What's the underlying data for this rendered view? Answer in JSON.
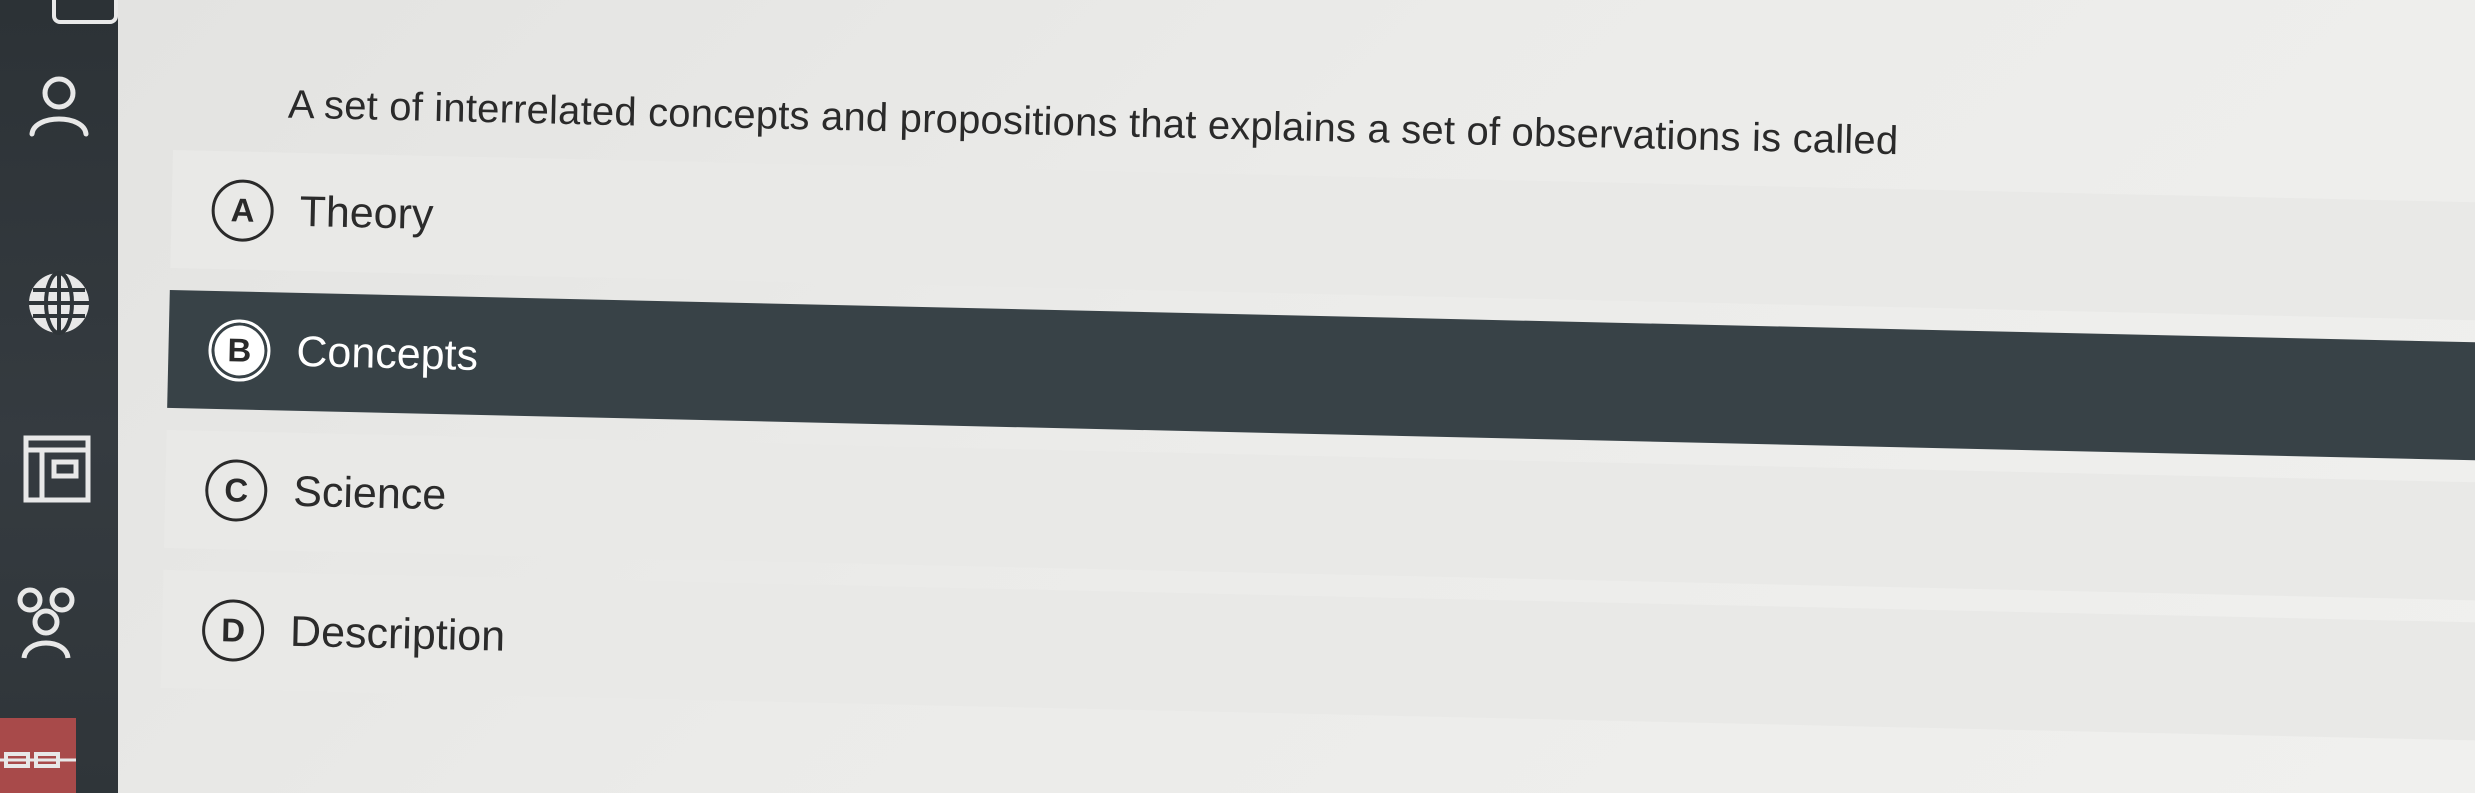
{
  "question": {
    "text": "A set of interrelated concepts and propositions that explains a set of observations is called"
  },
  "options": [
    {
      "letter": "A",
      "label": "Theory",
      "selected": false
    },
    {
      "letter": "B",
      "label": "Concepts",
      "selected": true
    },
    {
      "letter": "C",
      "label": "Science",
      "selected": false
    },
    {
      "letter": "D",
      "label": "Description",
      "selected": false
    }
  ],
  "sidebar": {
    "icons": [
      "profile-icon",
      "globe-icon",
      "calendar-icon",
      "people-icon",
      "grid-icon"
    ]
  },
  "colors": {
    "selected_bg": "#384247",
    "rail_bg": "#2f3539",
    "page_bg": "#e6e6e4",
    "text": "#2a2a2a"
  }
}
